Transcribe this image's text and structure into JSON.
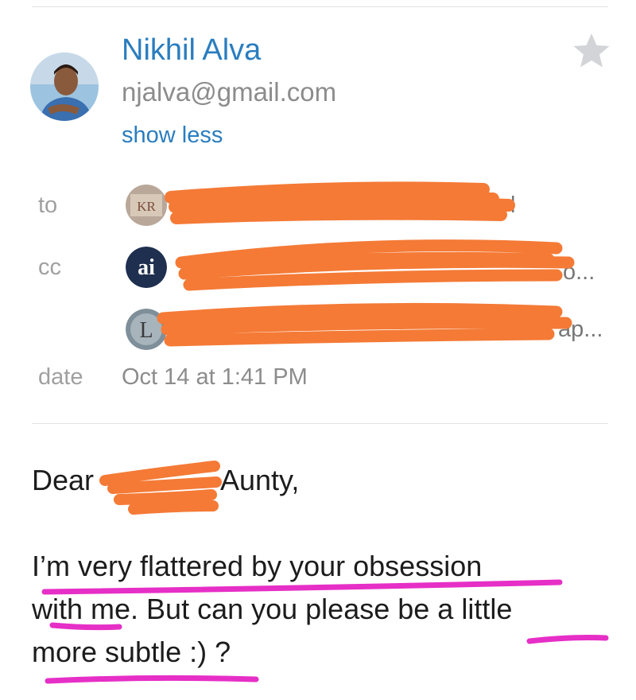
{
  "sender": {
    "name": "Nikhil Alva",
    "email": "njalva@gmail.com",
    "toggle_label": "show less"
  },
  "header_labels": {
    "to": "to",
    "cc": "cc",
    "date": "date"
  },
  "recipients": {
    "to": [
      {
        "initials": "KR",
        "visible_tail": "l"
      }
    ],
    "cc": [
      {
        "initials": "ai",
        "visible_tail": "o..."
      },
      {
        "initials": "L",
        "visible_tail": "ap..."
      }
    ]
  },
  "date": "Oct 14 at 1:41 PM",
  "body": {
    "greeting_start": "Dear",
    "greeting_end": "Aunty,",
    "line1": "I’m very flattered by your obsession",
    "line2": "with me. But can you please be a little",
    "line3": "more subtle :) ?"
  },
  "colors": {
    "accent": "#2a7dbf",
    "redaction": "#f47a36",
    "highlight": "#e62fc6"
  },
  "icons": {
    "star": "star-icon",
    "avatar": "avatar"
  }
}
